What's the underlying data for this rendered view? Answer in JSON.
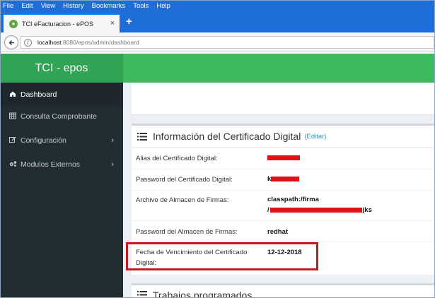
{
  "browser": {
    "menu": [
      "File",
      "Edit",
      "View",
      "History",
      "Bookmarks",
      "Tools",
      "Help"
    ],
    "tab_title": "TCI eFacturacion - ePOS",
    "tab_close": "×",
    "new_tab": "+",
    "url_host": "localhost",
    "url_rest": ":8080/epos/admin/dashboard"
  },
  "app": {
    "brand": "TCI - epos",
    "sidebar": [
      {
        "label": "Dashboard",
        "icon": "home-icon",
        "active": true
      },
      {
        "label": "Consulta Comprobante",
        "icon": "table-icon",
        "active": false
      },
      {
        "label": "Configuración",
        "icon": "edit-icon",
        "active": false,
        "has_submenu": true
      },
      {
        "label": "Modulos Externos",
        "icon": "cogs-icon",
        "active": false,
        "has_submenu": true
      }
    ],
    "certificate_box": {
      "title": "Información del Certificado Digital",
      "edit_link": "(Editar)",
      "rows": [
        {
          "label": "Alias del Certificado Digital:",
          "value": ""
        },
        {
          "label": "Password del Certificado Digital:",
          "value": "k"
        },
        {
          "label": "Archivo de Almacen de Firmas:",
          "value_line1": "classpath:/firma",
          "value_line2_prefix": "/",
          "value_line2_suffix": "jks"
        },
        {
          "label": "Password del Almacen de Firmas:",
          "value": "redhat"
        },
        {
          "label_line1": "Fecha de Vencimiento del Certificado",
          "label_line2": "Digital:",
          "value": "12-12-2018"
        }
      ]
    },
    "jobs_box": {
      "title": "Trabajos programados"
    }
  },
  "colors": {
    "brand_green": "#31a354",
    "topbar_green": "#3cba5e",
    "sidebar_bg": "#222d32",
    "link_blue": "#3c8dbc",
    "highlight_red": "#c8171f",
    "redaction_red": "#e0101a"
  }
}
